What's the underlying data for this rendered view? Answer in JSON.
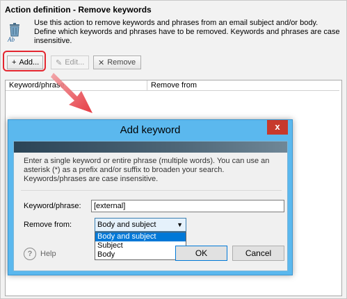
{
  "header": {
    "title": "Action definition - Remove keywords",
    "description": "Use this action to remove keywords and phrases from an email subject and/or body. Define which keywords and phrases have to be removed. Keywords and phrases are case insensitive."
  },
  "toolbar": {
    "add_label": "Add...",
    "edit_label": "Edit...",
    "remove_label": "Remove"
  },
  "table": {
    "columns": [
      "Keyword/phrase",
      "Remove from"
    ]
  },
  "dialog": {
    "title": "Add keyword",
    "close_glyph": "x",
    "description": "Enter a single keyword or entire phrase (multiple words). You can use an asterisk (*) as a prefix and/or suffix to broaden your search. Keywords/phrases are case insensitive.",
    "keyword_label": "Keyword/phrase:",
    "keyword_value": "[external]",
    "remove_from_label": "Remove from:",
    "remove_from_selected": "Body and subject",
    "remove_from_options": [
      "Body and subject",
      "Subject",
      "Body"
    ],
    "help_label": "Help",
    "ok_label": "OK",
    "cancel_label": "Cancel"
  },
  "colors": {
    "highlight": "#e3262f",
    "dialog_title_bar": "#5bb8ee",
    "close_button": "#c7392c",
    "selection": "#0078d7"
  }
}
